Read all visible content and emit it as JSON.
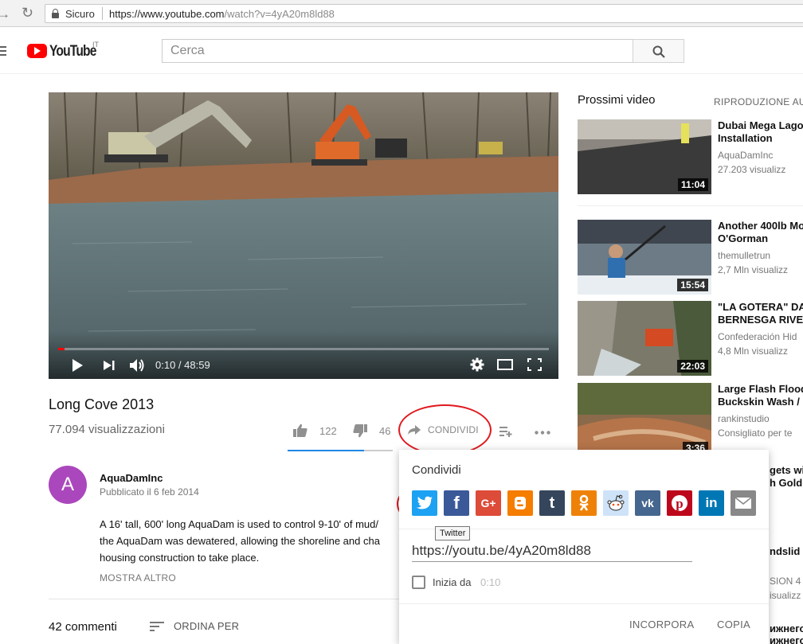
{
  "browser": {
    "secure_label": "Sicuro",
    "url_host": "https://www.youtube.com",
    "url_path": "/watch?v=4yA20m8ld88"
  },
  "masthead": {
    "logo_text": "YouTube",
    "country_code": "IT",
    "search_placeholder": "Cerca"
  },
  "player": {
    "time_display": "0:10 / 48:59",
    "progress_fraction": 0.0034
  },
  "video": {
    "title": "Long Cove 2013",
    "views": "77.094 visualizzazioni",
    "likes": "122",
    "dislikes": "46",
    "share_label": "CONDIVIDI"
  },
  "channel": {
    "avatar_letter": "A",
    "name": "AquaDamInc",
    "published": "Pubblicato il 6 feb 2014",
    "description_lines": [
      "A 16' tall, 600' long AquaDam is used to control 9-10' of mud/",
      "the AquaDam was dewatered, allowing the shoreline and cha",
      "housing construction to take place."
    ],
    "show_more": "MOSTRA ALTRO"
  },
  "comments": {
    "count_label": "42 commenti",
    "sort_label": "ORDINA PER"
  },
  "sidebar": {
    "up_next": "Prossimi video",
    "autoplay": "RIPRODUZIONE AU",
    "items": [
      {
        "title1": "Dubai Mega Lago",
        "title2": "Installation",
        "channel": "AquaDamInc",
        "views": "27.203 visualizz",
        "duration": "11:04"
      },
      {
        "title1": "Another 400lb Mo",
        "title2": "O'Gorman",
        "channel": "themulletrun",
        "views": "2,7 Mln visualizz",
        "duration": "15:54"
      },
      {
        "title1": "\"LA GOTERA\" DA",
        "title2": "BERNESGA RIVER",
        "channel": "Confederación Hid",
        "views": "4,8 Mln visualizz",
        "duration": "22:03"
      },
      {
        "title1": "Large Flash Flood",
        "title2": "Buckskin Wash /",
        "channel": "rankinstudio",
        "views": "Consigliato per te",
        "duration": "3:36"
      }
    ],
    "peeks": [
      "gets wit",
      "h Gold N",
      "ndslid",
      "SION 4",
      "isualizz",
      "ижнего",
      "ижнего"
    ]
  },
  "share_dialog": {
    "title": "Condividi",
    "services": [
      "Twitter",
      "Facebook",
      "Google+",
      "Blogger",
      "Tumblr",
      "Odnoklassniki",
      "Reddit",
      "VK",
      "Pinterest",
      "LinkedIn",
      "Email"
    ],
    "tooltip": "Twitter",
    "share_url": "https://youtu.be/4yA20m8ld88",
    "start_at_label": "Inizia da",
    "start_at_time": "0:10",
    "embed_label": "INCORPORA",
    "copy_label": "COPIA"
  },
  "colors": {
    "youtube_red": "#ff0000",
    "annotation_red": "#e0191e",
    "twitter": "#1da1f2",
    "facebook": "#3b5998",
    "googleplus": "#dd4b39",
    "blogger": "#f57d00",
    "tumblr": "#35465c",
    "odnoklassniki": "#ee8208",
    "reddit": "#cee3f8",
    "vk": "#45668e",
    "pinterest": "#bd081c",
    "linkedin": "#0077b5",
    "email": "#888888"
  }
}
